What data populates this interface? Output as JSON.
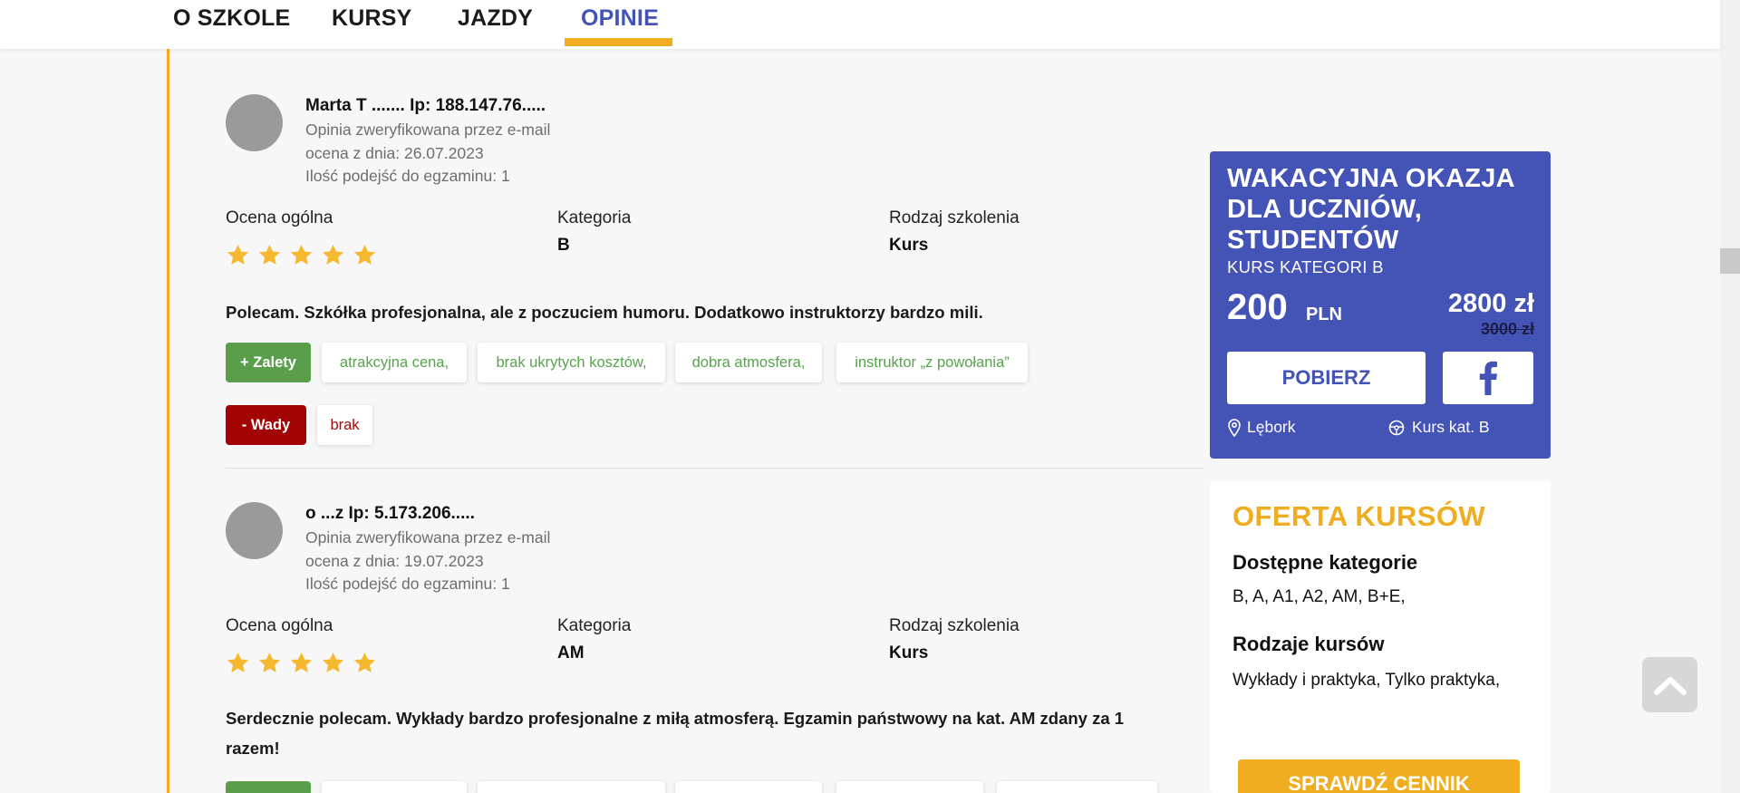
{
  "nav": {
    "items": [
      "O SZKOLE",
      "KURSY",
      "JAZDY",
      "OPINIE"
    ],
    "active": "OPINIE"
  },
  "reviews": [
    {
      "name": "Marta T ....... Ip: 188.147.76.....",
      "verified": "Opinia zweryfikowana przez e-mail",
      "date": "ocena z dnia: 26.07.2023",
      "attempts": "Ilość podejść do egzaminu: 1",
      "rating_label": "Ocena ogólna",
      "rating": 5,
      "category_label": "Kategoria",
      "category": "B",
      "type_label": "Rodzaj szkolenia",
      "type": "Kurs",
      "text": "Polecam. Szkółka profesjonalna, ale z poczuciem humoru. Dodatkowo instruktorzy bardzo mili.",
      "pros_label": "+ Zalety",
      "pros": [
        "atrakcyjna cena,",
        "brak ukrytych kosztów,",
        "dobra atmosfera,",
        "instruktor „z powołania”"
      ],
      "cons_label": "- Wady",
      "cons": [
        "brak"
      ]
    },
    {
      "name": "o ...z Ip: 5.173.206.....",
      "verified": "Opinia zweryfikowana przez e-mail",
      "date": "ocena z dnia: 19.07.2023",
      "attempts": "Ilość podejść do egzaminu: 1",
      "rating_label": "Ocena ogólna",
      "rating": 5,
      "category_label": "Kategoria",
      "category": "AM",
      "type_label": "Rodzaj szkolenia",
      "type": "Kurs",
      "text": "Serdecznie polecam. Wykłady bardzo profesjonalne z miłą atmosferą. Egzamin państwowy na kat. AM zdany za 1 razem!"
    }
  ],
  "promo": {
    "title": "WAKACYJNA OKAZJA DLA UCZNIÓW, STUDENTÓW",
    "subtitle": "KURS KATEGORI B",
    "price": "200",
    "price_unit": "PLN",
    "new_price": "2800 zł",
    "old_price": "3000 zł",
    "download_label": "POBIERZ",
    "location": "Lębork",
    "course": "Kurs kat. B"
  },
  "offer": {
    "title": "OFERTA KURSÓW",
    "categories_heading": "Dostępne kategorie",
    "categories": "B, A, A1, A2, AM, B+E,",
    "types_heading": "Rodzaje kursów",
    "types": "Wykłady i praktyka, Tylko praktyka,",
    "cta": "SPRAWDŹ CENNIK"
  },
  "colors": {
    "accent_blue": "#4453b6",
    "accent_gold": "#f0ad1f",
    "pro_green": "#5a9e4c",
    "con_red": "#a30505",
    "star": "#f5b82e"
  }
}
